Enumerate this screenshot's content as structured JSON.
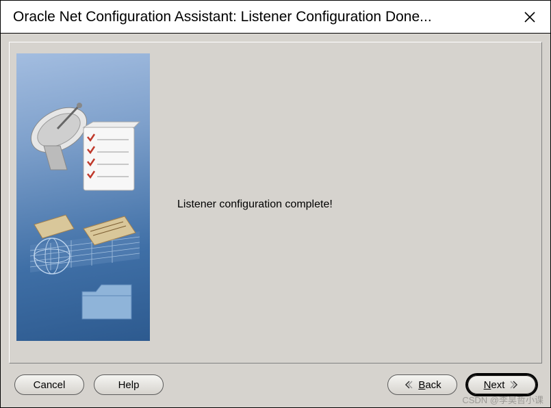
{
  "window": {
    "title": "Oracle Net Configuration Assistant: Listener Configuration Done..."
  },
  "main": {
    "message": "Listener configuration complete!"
  },
  "buttons": {
    "cancel": "Cancel",
    "help": "Help",
    "back_prefix": "B",
    "back_rest": "ack",
    "next_prefix": "N",
    "next_rest": "ext"
  },
  "watermark": "CSDN @李昊哲小课"
}
